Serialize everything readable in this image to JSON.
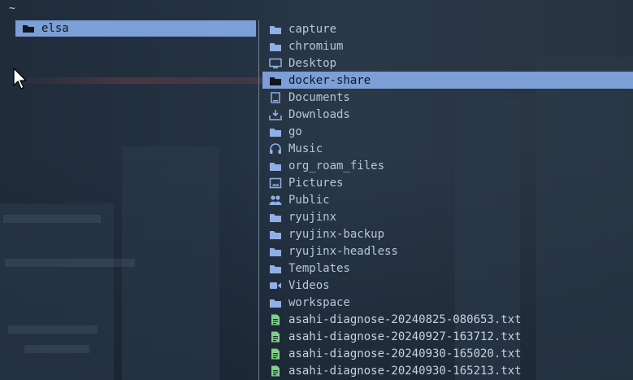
{
  "prompt": {
    "cwd": "~"
  },
  "left_pane": {
    "items": [
      {
        "label": "elsa",
        "icon": "folder-icon",
        "selected": true
      }
    ]
  },
  "right_pane": {
    "items": [
      {
        "label": "capture",
        "icon": "folder-icon"
      },
      {
        "label": "chromium",
        "icon": "folder-icon"
      },
      {
        "label": "Desktop",
        "icon": "desktop-icon"
      },
      {
        "label": "docker-share",
        "icon": "folder-icon",
        "selected": true
      },
      {
        "label": "Documents",
        "icon": "documents-icon"
      },
      {
        "label": "Downloads",
        "icon": "download-icon"
      },
      {
        "label": "go",
        "icon": "folder-icon"
      },
      {
        "label": "Music",
        "icon": "headphones-icon"
      },
      {
        "label": "org_roam_files",
        "icon": "folder-icon"
      },
      {
        "label": "Pictures",
        "icon": "pictures-icon"
      },
      {
        "label": "Public",
        "icon": "users-icon"
      },
      {
        "label": "ryujinx",
        "icon": "folder-icon"
      },
      {
        "label": "ryujinx-backup",
        "icon": "folder-icon"
      },
      {
        "label": "ryujinx-headless",
        "icon": "folder-icon"
      },
      {
        "label": "Templates",
        "icon": "folder-icon"
      },
      {
        "label": "Videos",
        "icon": "video-icon"
      },
      {
        "label": "workspace",
        "icon": "folder-icon"
      },
      {
        "label": "asahi-diagnose-20240825-080653.txt",
        "icon": "text-file-icon"
      },
      {
        "label": "asahi-diagnose-20240927-163712.txt",
        "icon": "text-file-icon"
      },
      {
        "label": "asahi-diagnose-20240930-165020.txt",
        "icon": "text-file-icon"
      },
      {
        "label": "asahi-diagnose-20240930-165213.txt",
        "icon": "text-file-icon"
      }
    ]
  },
  "colors": {
    "selection_bg": "#7b9fd6",
    "dir_icon": "#8fb0e6",
    "file_icon": "#7fd08a",
    "text": "#b8c6d8"
  }
}
